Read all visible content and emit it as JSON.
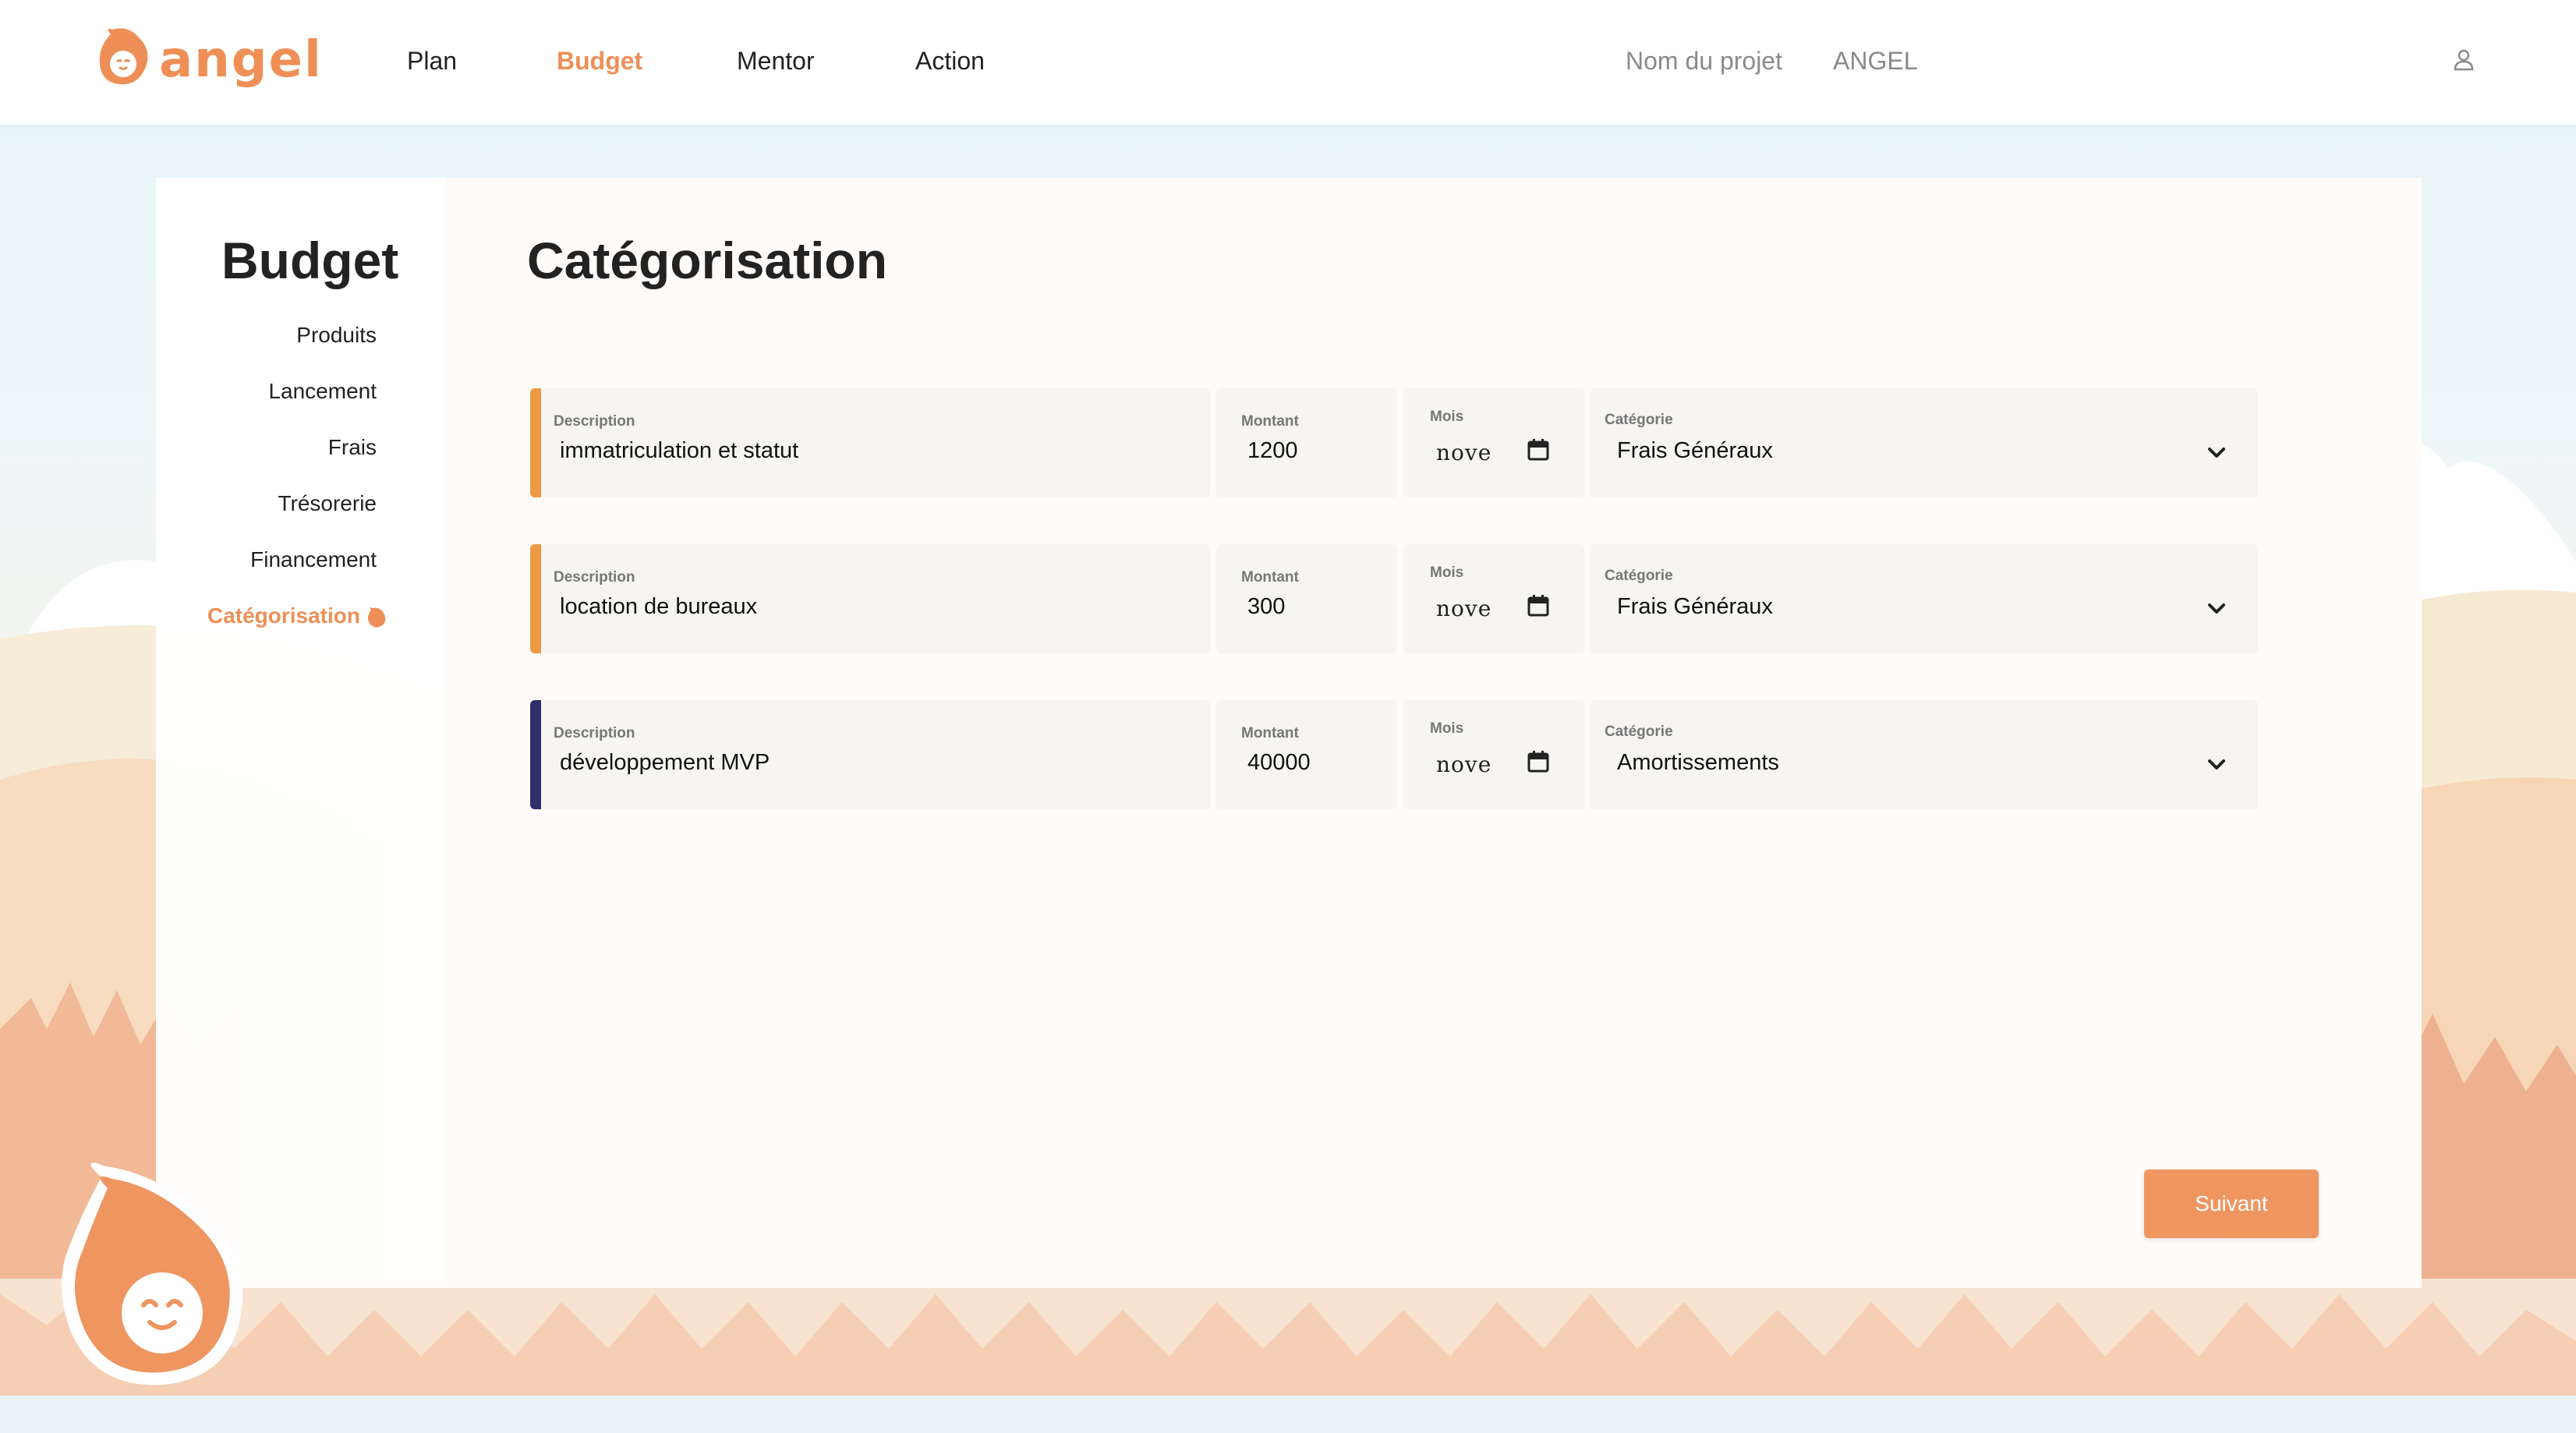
{
  "brand": {
    "name": "angel",
    "accent": "#ee8f57",
    "logo_icon": "angel-mascot-logo"
  },
  "nav": {
    "items": [
      {
        "label": "Plan",
        "active": false
      },
      {
        "label": "Budget",
        "active": true
      },
      {
        "label": "Mentor",
        "active": false
      },
      {
        "label": "Action",
        "active": false
      }
    ],
    "project_label": "Nom du projet",
    "project_name": "ANGEL",
    "user_icon": "user-icon"
  },
  "sidebar": {
    "title": "Budget",
    "items": [
      {
        "label": "Produits",
        "active": false
      },
      {
        "label": "Lancement",
        "active": false
      },
      {
        "label": "Frais",
        "active": false
      },
      {
        "label": "Trésorerie",
        "active": false
      },
      {
        "label": "Financement",
        "active": false
      },
      {
        "label": "Catégorisation",
        "active": true
      }
    ]
  },
  "main": {
    "title": "Catégorisation",
    "labels": {
      "description": "Description",
      "montant": "Montant",
      "mois": "Mois",
      "categorie": "Catégorie"
    },
    "rows": [
      {
        "description": "immatriculation et statut",
        "montant": "1200",
        "mois": "nove",
        "categorie": "Frais Généraux",
        "accent": "#ee9a45"
      },
      {
        "description": "location de bureaux",
        "montant": "300",
        "mois": "nove",
        "categorie": "Frais Généraux",
        "accent": "#ee9a45"
      },
      {
        "description": "développement MVP",
        "montant": "40000",
        "mois": "nove",
        "categorie": "Amortissements",
        "accent": "#2d2f6b"
      }
    ],
    "next_button": "Suivant"
  },
  "colors": {
    "accent": "#ee8f57",
    "button": "#ef9560",
    "row_accent_orange": "#ee9a45",
    "row_accent_navy": "#2d2f6b"
  }
}
